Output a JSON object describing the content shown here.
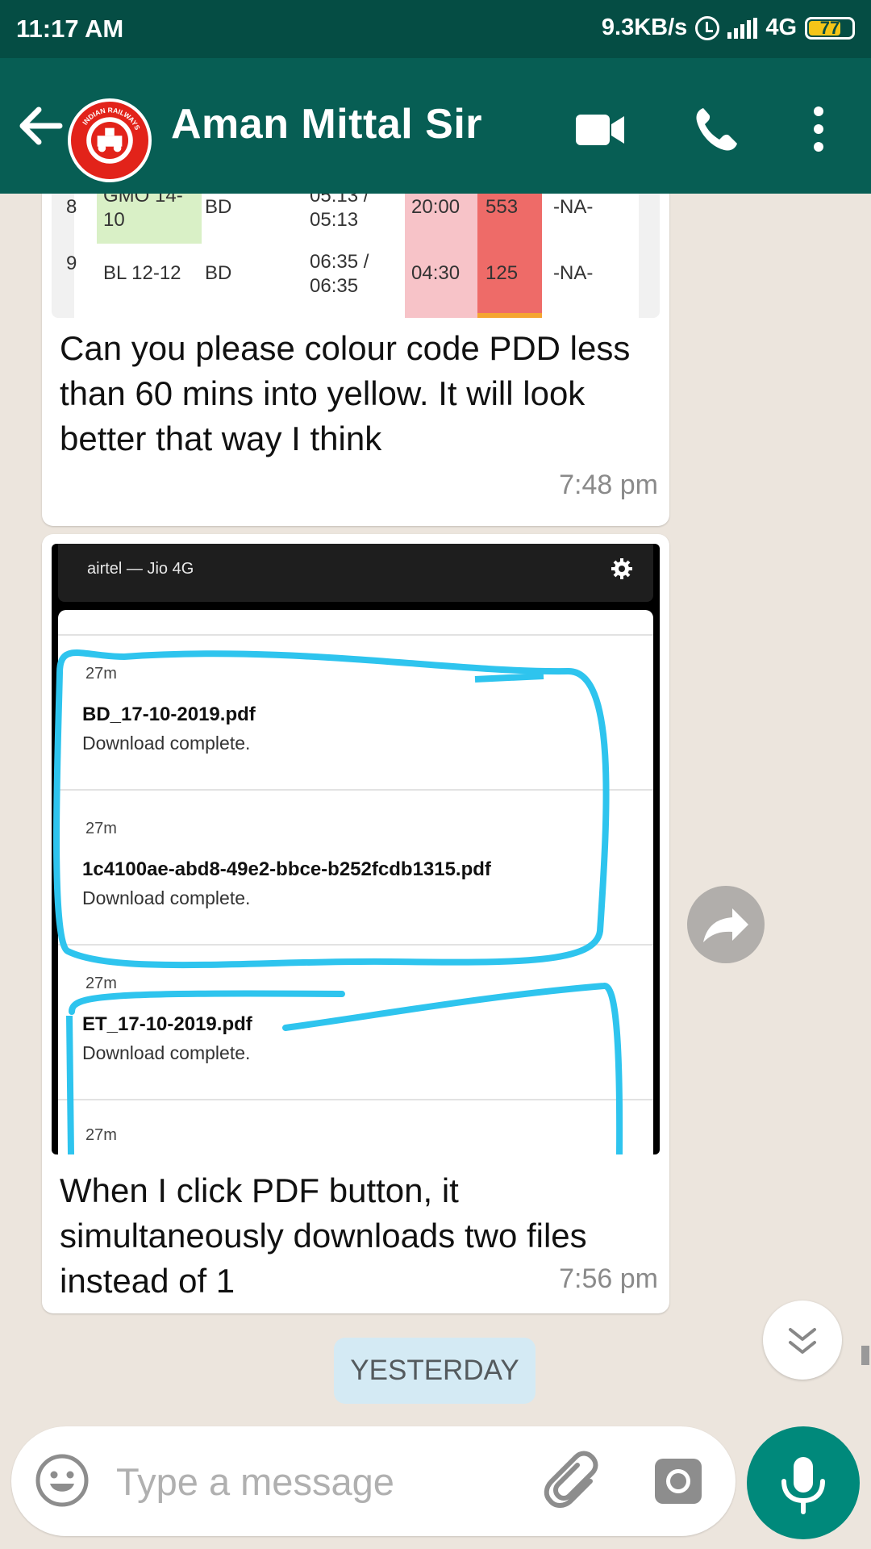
{
  "status_bar": {
    "time": "11:17 AM",
    "network_speed": "9.3KB/s",
    "network_type": "4G",
    "battery": "77"
  },
  "header": {
    "title": "Aman Mittal Sir",
    "avatar": "indian-railways-logo",
    "avatar_text": "INDIAN RAILWAYS"
  },
  "messages": [
    {
      "table_rows": [
        {
          "left": "8",
          "name": "GMO 14-10",
          "div": "BD",
          "time": "05:13 / 05:13",
          "p1": "20:00",
          "p2": "553",
          "last": "-NA-"
        },
        {
          "left": "9",
          "name": "BL 12-12",
          "div": "BD",
          "time": "06:35 / 06:35",
          "p1": "04:30",
          "p2": "125",
          "last": "-NA-"
        }
      ],
      "text": "Can you please colour code PDD less than 60 mins into yellow. It will look better that way I think",
      "time": "7:48 pm"
    },
    {
      "image": {
        "carrier": "airtel — Jio 4G",
        "notifications": [
          {
            "age": "27m",
            "file": "BD_17-10-2019.pdf",
            "status": "Download complete."
          },
          {
            "age": "27m",
            "file": "1c4100ae-abd8-49e2-bbce-b252fcdb1315.pdf",
            "status": "Download complete."
          },
          {
            "age": "27m",
            "file": "ET_17-10-2019.pdf",
            "status": "Download complete."
          },
          {
            "age": "27m"
          }
        ]
      },
      "text": "When I click PDF button, it simultaneously downloads two files instead of 1",
      "time": "7:56 pm"
    }
  ],
  "date_divider": "YESTERDAY",
  "composer": {
    "placeholder": "Type a message"
  },
  "colors": {
    "header": "#075e54",
    "status_bar": "#054d44",
    "accent": "#00897b",
    "highlight_marker": "#2ec4ee"
  }
}
